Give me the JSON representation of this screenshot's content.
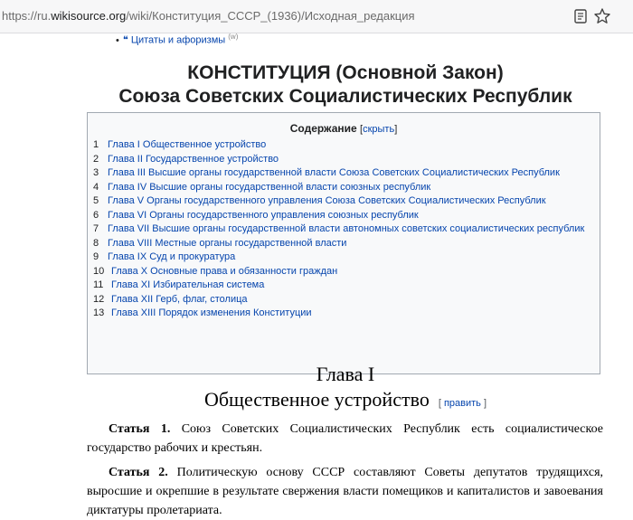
{
  "browser": {
    "url_prefix": "https://ru.",
    "url_domain": "wikisource.org",
    "url_path": "/wiki/Конституция_СССР_(1936)/Исходная_редакция"
  },
  "prev_item": {
    "bullet": "•",
    "icon": "quote-icon",
    "label": "Цитаты и афоризмы",
    "ext": "(w)"
  },
  "title": {
    "line1": "КОНСТИТУЦИЯ (Основной Закон)",
    "line2": "Союза Советских Социалистических Республик"
  },
  "toc": {
    "heading": "Содержание",
    "toggle_open": "[",
    "toggle": "скрыть",
    "toggle_close": "]",
    "items": [
      {
        "num": "1",
        "label": "Глава I Общественное устройство"
      },
      {
        "num": "2",
        "label": "Глава II Государственное устройство"
      },
      {
        "num": "3",
        "label": "Глава III Высшие органы государственной власти Союза Советских Социалистических Республик"
      },
      {
        "num": "4",
        "label": "Глава IV Высшие органы государственной власти союзных республик"
      },
      {
        "num": "5",
        "label": "Глава V Органы государственного управления Союза Советских Социалистических Республик"
      },
      {
        "num": "6",
        "label": "Глава VI Органы государственного управления союзных республик"
      },
      {
        "num": "7",
        "label": "Глава VII Высшие органы государственной власти автономных советских социалистических республик"
      },
      {
        "num": "8",
        "label": "Глава VIII Местные органы государственной власти"
      },
      {
        "num": "9",
        "label": "Глава IX Суд и прокуратура"
      },
      {
        "num": "10",
        "label": "Глава X Основные права и обязанности граждан"
      },
      {
        "num": "11",
        "label": "Глава XI Избирательная система"
      },
      {
        "num": "12",
        "label": "Глава XII Герб, флаг, столица"
      },
      {
        "num": "13",
        "label": "Глава XIII Порядок изменения Конституции"
      }
    ]
  },
  "chapter": {
    "line1": "Глава I",
    "line2": "Общественное устройство",
    "edit_open": "[",
    "edit_label": "править",
    "edit_close": "]"
  },
  "articles": [
    {
      "label": "Статья 1.",
      "text": "Союз Советских Социалистических Республик есть социалистическое государство рабочих и крестьян."
    },
    {
      "label": "Статья 2.",
      "text": "Политическую основу СССР составляют Советы депутатов трудящихся, выросшие и окрепшие в результате свержения власти помещиков и капиталистов и завоевания диктатуры пролетариата."
    }
  ]
}
